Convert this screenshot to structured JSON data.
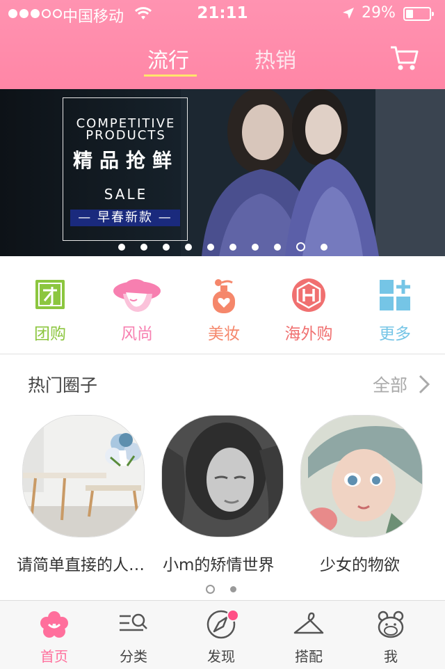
{
  "status_bar": {
    "carrier": "中国移动",
    "time": "21:11",
    "battery": "29%"
  },
  "header": {
    "tabs": [
      {
        "label": "流行",
        "active": true
      },
      {
        "label": "热销",
        "active": false
      }
    ],
    "cart_icon": "cart-icon",
    "accent_color": "#ff8fac",
    "underline_color": "#ffe66b"
  },
  "banner": {
    "en_title": "COMPETITIVE PRODUCTS",
    "cn_title": "精品抢鲜",
    "sale": "SALE",
    "tag": "— 早春新款 —",
    "page_count": 10,
    "current_page": 9
  },
  "categories": [
    {
      "label": "团购",
      "icon": "group-buy-icon",
      "color": "#8cc63f"
    },
    {
      "label": "风尚",
      "icon": "hat-icon",
      "color": "#f77fb0"
    },
    {
      "label": "美妆",
      "icon": "perfume-icon",
      "color": "#f5876b"
    },
    {
      "label": "海外购",
      "icon": "overseas-h-icon",
      "color": "#f07070"
    },
    {
      "label": "更多",
      "icon": "more-grid-icon",
      "color": "#75c5e6"
    }
  ],
  "hot_circles": {
    "title": "热门圈子",
    "see_all": "全部",
    "items": [
      {
        "name": "请简单直接的人…"
      },
      {
        "name": "小m的矫情世界"
      },
      {
        "name": "少女的物欲"
      }
    ]
  },
  "bottom_nav": [
    {
      "label": "首页",
      "icon": "flower-home-icon",
      "active": true
    },
    {
      "label": "分类",
      "icon": "category-search-icon",
      "active": false
    },
    {
      "label": "发现",
      "icon": "compass-icon",
      "active": false
    },
    {
      "label": "搭配",
      "icon": "hanger-icon",
      "active": false
    },
    {
      "label": "我",
      "icon": "bear-face-icon",
      "active": false
    }
  ]
}
